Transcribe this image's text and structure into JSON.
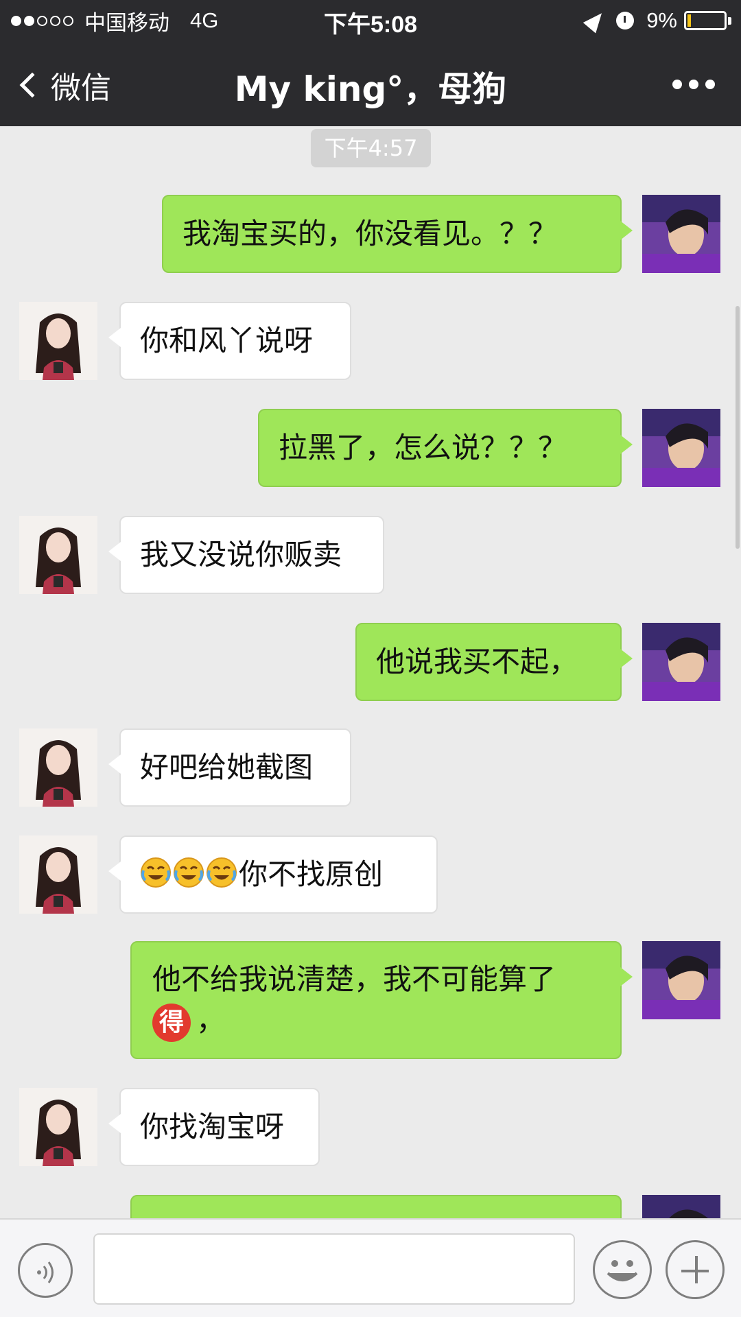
{
  "status_bar": {
    "signal_dots_filled": 2,
    "signal_dots_total": 5,
    "carrier": "中国移动",
    "network": "4G",
    "time": "下午5:08",
    "battery_percent": "9%",
    "battery_level": 0.09
  },
  "nav": {
    "back_label": "微信",
    "title": "My king°，母狗"
  },
  "chat": {
    "timestamp": "下午4:57",
    "messages": [
      {
        "side": "sent",
        "text": "我淘宝买的，你没看见。？？"
      },
      {
        "side": "recv",
        "text": "你和风丫说呀"
      },
      {
        "side": "sent",
        "text": "拉黑了，怎么说？？？"
      },
      {
        "side": "recv",
        "text": "我又没说你贩卖"
      },
      {
        "side": "sent",
        "text": "他说我买不起，"
      },
      {
        "side": "recv",
        "text": "好吧给她截图"
      },
      {
        "side": "recv",
        "text": "你不找原创",
        "emoji": "crying-laugh",
        "emoji_count": 3
      },
      {
        "side": "sent",
        "line1": "他不给我说清楚，我不可能算了",
        "badge": "得",
        "line2_suffix": "，"
      },
      {
        "side": "recv",
        "text": "你找淘宝呀"
      },
      {
        "side": "sent",
        "text": ""
      }
    ]
  },
  "input_bar": {
    "text_value": ""
  },
  "colors": {
    "header_bg": "#2b2b2e",
    "chat_bg": "#ebebeb",
    "sent_bubble": "#9fe659",
    "recv_bubble": "#ffffff",
    "battery_fill": "#f5c518"
  }
}
